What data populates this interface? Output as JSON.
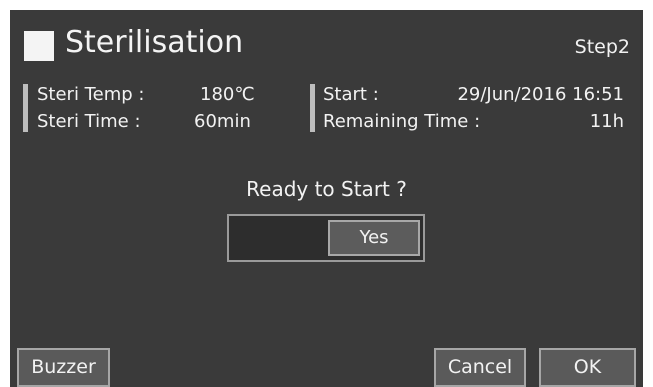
{
  "header": {
    "title": "Sterilisation",
    "step": "Step2"
  },
  "info": {
    "temp_label": "Steri Temp :",
    "temp_value": "180℃",
    "time_label": "Steri Time  :",
    "time_value": "60min",
    "start_label": "Start :",
    "start_value": "29/Jun/2016 16:51",
    "remaining_label": "Remaining Time :",
    "remaining_value": "11h"
  },
  "prompt": {
    "text": "Ready to Start ?",
    "yes_label": "Yes"
  },
  "buttons": {
    "buzzer": "Buzzer",
    "cancel": "Cancel",
    "ok": "OK"
  }
}
